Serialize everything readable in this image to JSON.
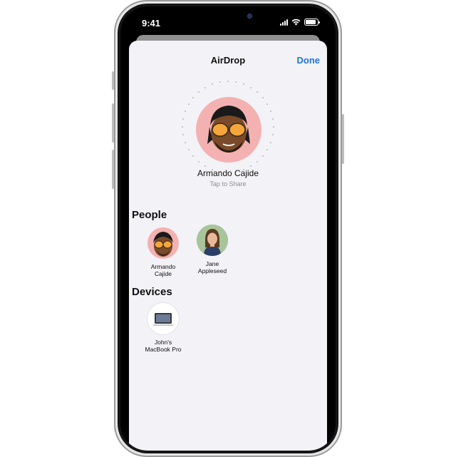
{
  "status_bar": {
    "time": "9:41"
  },
  "sheet": {
    "title": "AirDrop",
    "done_label": "Done",
    "hero": {
      "name": "Armando Cajide",
      "subtitle": "Tap to Share"
    }
  },
  "people": {
    "title": "People",
    "items": [
      {
        "line1": "Armando",
        "line2": "Cajide"
      },
      {
        "line1": "Jane",
        "line2": "Appleseed"
      }
    ]
  },
  "devices": {
    "title": "Devices",
    "items": [
      {
        "line1": "John's",
        "line2": "MacBook Pro"
      }
    ]
  },
  "colors": {
    "accent": "#1e74e6",
    "avatar_ring": "#f4b1b1",
    "sheet_bg": "#f2f2f7"
  },
  "icons": [
    "signal-icon",
    "wifi-icon",
    "battery-icon",
    "laptop-icon"
  ]
}
